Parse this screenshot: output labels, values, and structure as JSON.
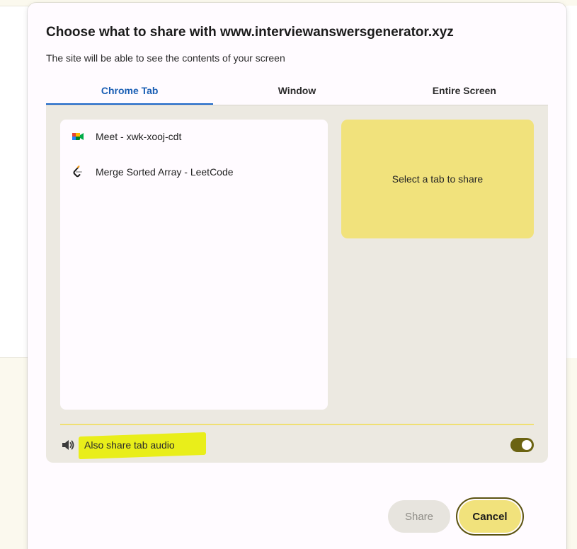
{
  "dialog": {
    "title": "Choose what to share with www.interviewanswersgenerator.xyz",
    "subtitle": "The site will be able to see the contents of your screen"
  },
  "tabs": [
    {
      "label": "Chrome Tab",
      "active": true
    },
    {
      "label": "Window",
      "active": false
    },
    {
      "label": "Entire Screen",
      "active": false
    }
  ],
  "tab_list": [
    {
      "label": "Meet - xwk-xooj-cdt",
      "icon": "google-meet-icon"
    },
    {
      "label": "Merge Sorted Array - LeetCode",
      "icon": "leetcode-icon"
    }
  ],
  "preview": {
    "text": "Select a tab to share"
  },
  "audio": {
    "label": "Also share tab audio",
    "enabled": true,
    "icon": "speaker-icon"
  },
  "buttons": {
    "share": "Share",
    "cancel": "Cancel"
  },
  "colors": {
    "accent": "#1a66c9",
    "preview_bg": "#f1e27c",
    "toggle_on": "#6b6312",
    "highlight": "#e9ee1a"
  }
}
